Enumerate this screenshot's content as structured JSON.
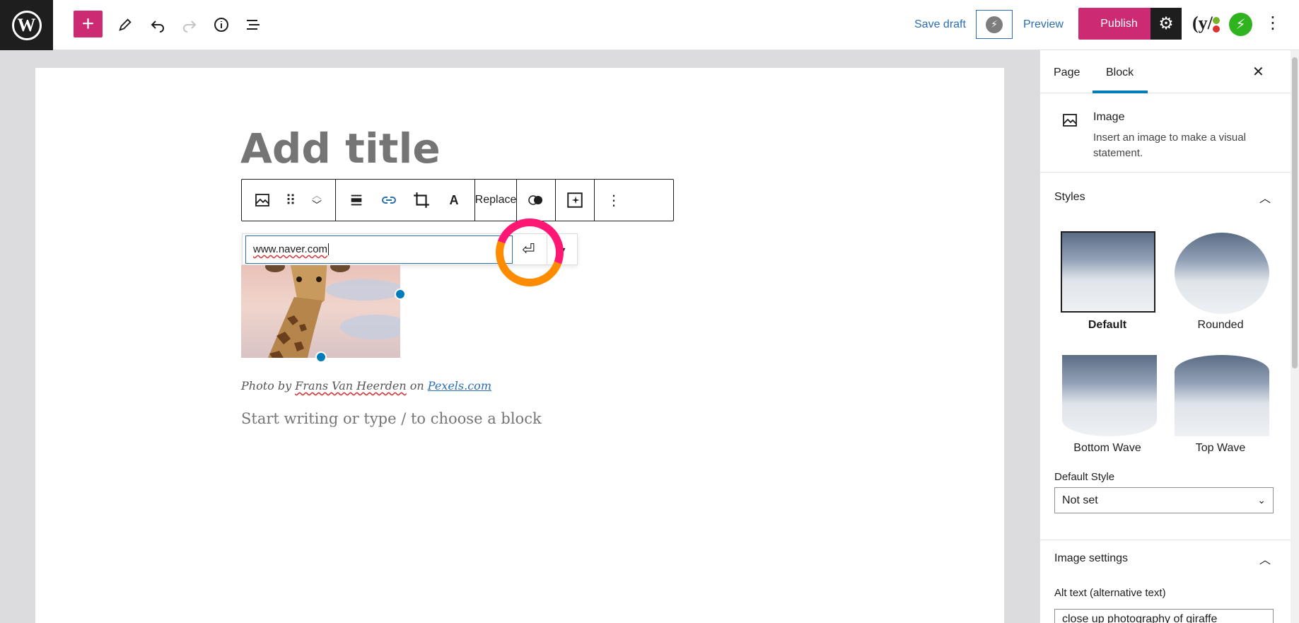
{
  "topbar": {
    "save_draft": "Save draft",
    "preview": "Preview",
    "publish": "Publish",
    "yoast_label": "(y/",
    "icons": [
      "wordpress-icon",
      "plus-icon",
      "pencil-icon",
      "undo-icon",
      "redo-icon",
      "info-icon",
      "list-view-icon",
      "bolt-icon",
      "gear-icon",
      "yoast-icon",
      "jetpack-icon",
      "more-vertical-icon"
    ]
  },
  "editor": {
    "title_placeholder": "Add title",
    "toolbar": {
      "replace_label": "Replace",
      "icons": [
        "image-icon",
        "drag-handle-icon",
        "move-up-down-icon",
        "align-icon",
        "link-icon",
        "crop-icon",
        "text-overlay-icon",
        "duotone-icon",
        "ai-sparkle-icon",
        "more-options-icon"
      ]
    },
    "link_input_value": "www.naver.com",
    "caption": {
      "prefix": "Photo by ",
      "author": "Frans Van Heerden",
      "middle": " on ",
      "site": "Pexels.com"
    },
    "block_placeholder": "Start writing or type / to choose a block"
  },
  "sidebar": {
    "tabs": [
      {
        "label": "Page"
      },
      {
        "label": "Block"
      }
    ],
    "active_tab": "Block",
    "block_card": {
      "title": "Image",
      "description": "Insert an image to make a visual statement."
    },
    "styles": {
      "heading": "Styles",
      "options": [
        {
          "label": "Default",
          "selected": true
        },
        {
          "label": "Rounded"
        },
        {
          "label": "Bottom Wave"
        },
        {
          "label": "Top Wave"
        }
      ],
      "default_style_label": "Default Style",
      "default_style_value": "Not set"
    },
    "image_settings": {
      "heading": "Image settings",
      "alt_label": "Alt text (alternative text)",
      "alt_value": "close up photography of giraffe"
    }
  },
  "colors": {
    "accent": "#cc2b73",
    "link": "#2a6fb1",
    "selection_blue": "#007cba",
    "ring_pink": "#ff1774",
    "ring_orange": "#ff8c00"
  }
}
